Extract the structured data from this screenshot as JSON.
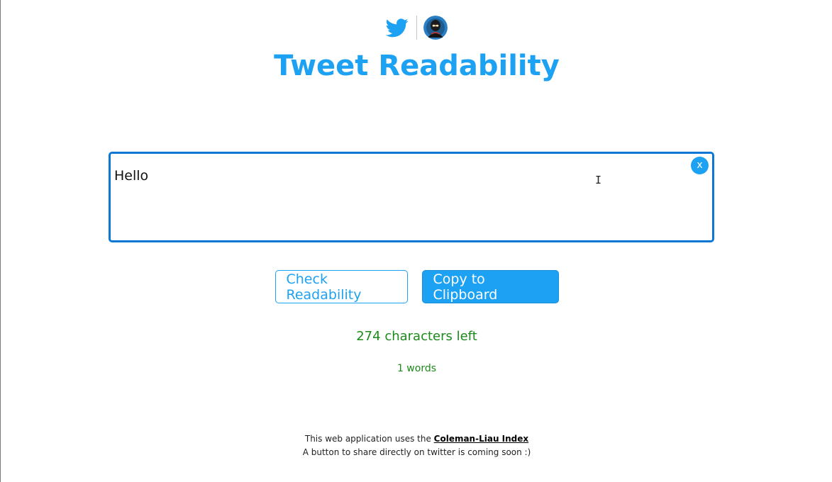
{
  "header": {
    "twitter_icon": "twitter-bird-icon",
    "avatar": "user-avatar",
    "title": "Tweet Readability"
  },
  "editor": {
    "value": "Hello",
    "clear_label": "x"
  },
  "actions": {
    "check_label": "Check Readability",
    "copy_label": "Copy to Clipboard"
  },
  "stats": {
    "chars_left": "274 characters left",
    "word_count": "1 words"
  },
  "footer": {
    "line1_prefix": "This web application uses the ",
    "link_label": "Coleman-Liau Index",
    "line2": "A button to share directly on twitter is coming soon :)"
  },
  "colors": {
    "accent": "#1da1f2",
    "editor_border": "#0d77d6",
    "stats_green": "#1a8a1a"
  }
}
